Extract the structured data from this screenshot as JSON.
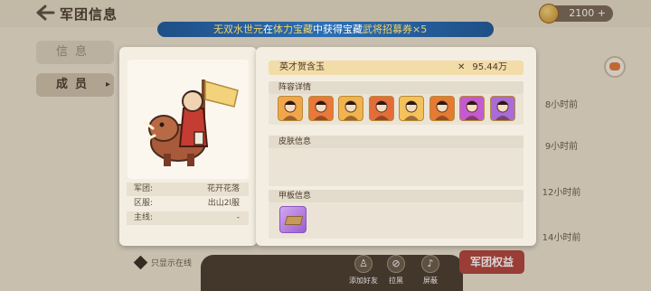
{
  "header": {
    "back_icon": "back-arrow-icon",
    "title": "军团信息",
    "currency_value": "2100",
    "currency_plus": "+"
  },
  "ticker": {
    "parts": [
      "无双水世元",
      "在",
      "体力宝藏",
      "中获得宝藏",
      "武将招募券×5"
    ]
  },
  "tabs": {
    "info": "信息",
    "member": "成员"
  },
  "member_list": {
    "time_values": [
      "8小时前",
      "9小时前",
      "12小时前",
      "14小时前"
    ]
  },
  "bottom": {
    "only_online_label": "只显示在线",
    "add_friend": "添加好友",
    "pull_black": "拉黑",
    "block": "屏蔽",
    "privilege": "军团权益"
  },
  "profile": {
    "legion_label": "军团:",
    "legion_value": "花开花落",
    "server_label": "区服:",
    "server_value": "出山2l服",
    "mainline_label": "主线:",
    "mainline_value": "-"
  },
  "detail": {
    "player_name": "英才贺含玉",
    "power_icon": "crossed-swords-icon",
    "power_value": "95.44万",
    "formation_title": "阵容详情",
    "skin_title": "皮肤信息",
    "deck_title": "甲板信息"
  },
  "colors": {
    "accent_red": "#b3453d",
    "ticker_blue": "#2b6eb3",
    "name_bar": "#f2dca8"
  },
  "heroes": [
    {
      "name": "hero-1",
      "bg": "#f1a64a"
    },
    {
      "name": "hero-2",
      "bg": "#e8793a"
    },
    {
      "name": "hero-3",
      "bg": "#f0b34d"
    },
    {
      "name": "hero-4",
      "bg": "#e36d3a"
    },
    {
      "name": "hero-5",
      "bg": "#f4c25b"
    },
    {
      "name": "hero-6",
      "bg": "#e57a33"
    },
    {
      "name": "hero-7",
      "bg": "#c45ad0"
    },
    {
      "name": "hero-8",
      "bg": "#a86bd8"
    }
  ]
}
